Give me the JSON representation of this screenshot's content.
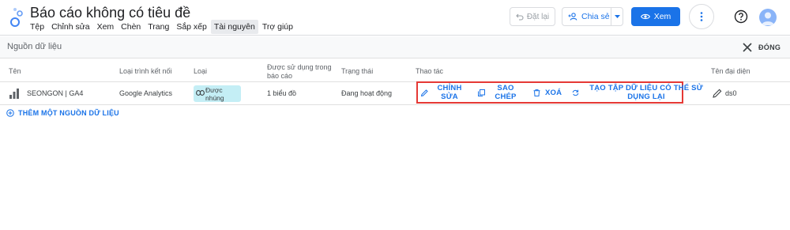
{
  "app": {
    "title": "Báo cáo không có tiêu đề",
    "menu": [
      "Tệp",
      "Chỉnh sửa",
      "Xem",
      "Chèn",
      "Trang",
      "Sắp xếp",
      "Tài nguyên",
      "Trợ giúp"
    ],
    "active_menu": "Tài nguyên"
  },
  "toolbar": {
    "undo_label": "Đặt lại",
    "share_label": "Chia sẻ",
    "view_label": "Xem"
  },
  "panel": {
    "title": "Nguồn dữ liệu",
    "close_label": "ĐÓNG"
  },
  "table": {
    "headers": {
      "name": "Tên",
      "connector": "Loại trình kết nối",
      "type": "Loại",
      "used_in_line1": "Được sử dụng trong",
      "used_in_line2": "báo cáo",
      "status": "Trạng thái",
      "actions": "Thao tác",
      "alias": "Tên đại diện"
    },
    "rows": [
      {
        "name": "SEONGON | GA4",
        "connector": "Google Analytics",
        "type_line1": "Được",
        "type_line2": "nhúng",
        "used_in": "1 biểu đồ",
        "status": "Đang hoạt động",
        "alias": "ds0"
      }
    ],
    "actions": {
      "edit_line1": "CHỈNH",
      "edit_line2": "SỬA",
      "copy_line1": "SAO",
      "copy_line2": "CHÉP",
      "delete": "XOÁ",
      "reusable_line1": "TẠO TẬP DỮ LIỆU CÓ THỂ SỬ",
      "reusable_line2": "DỤNG LẠI"
    }
  },
  "add_source_label": "THÊM MỘT NGUỒN DỮ LIỆU",
  "colors": {
    "accent": "#1a73e8",
    "highlight_box": "#e53935",
    "embedded_chip": "#c4eef5"
  }
}
